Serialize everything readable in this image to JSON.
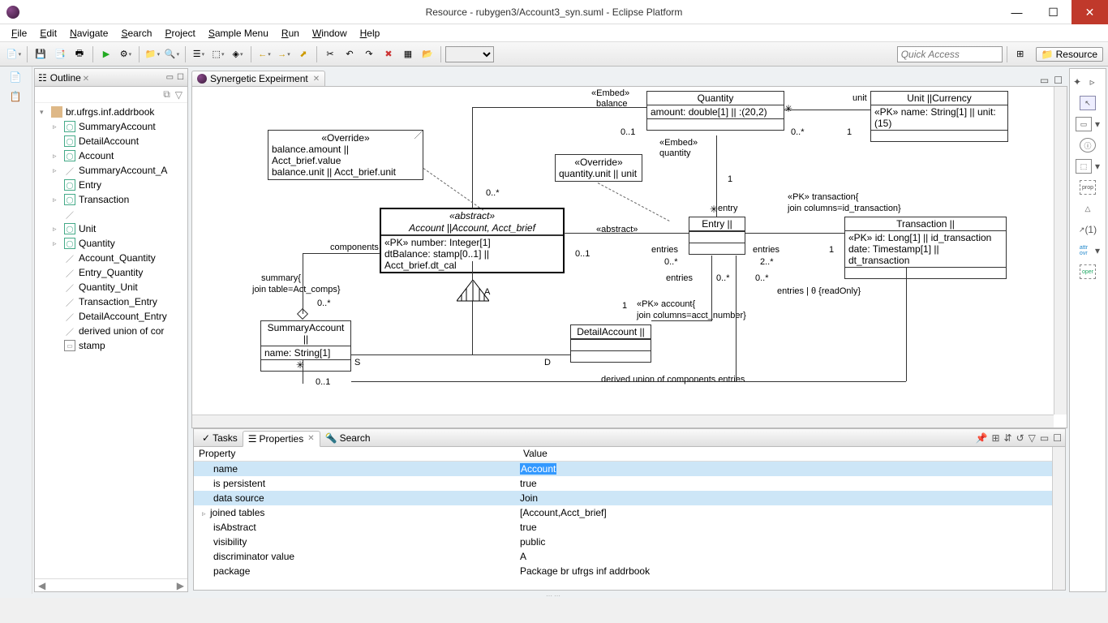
{
  "titlebar": {
    "title": "Resource - rubygen3/Account3_syn.suml - Eclipse Platform"
  },
  "menu": [
    "File",
    "Edit",
    "Navigate",
    "Search",
    "Project",
    "Sample Menu",
    "Run",
    "Window",
    "Help"
  ],
  "quick_access_placeholder": "Quick Access",
  "perspective_label": "Resource",
  "outline": {
    "title": "Outline",
    "root": "br.ufrgs.inf.addrbook",
    "items": [
      {
        "icon": "c",
        "label": "SummaryAccount",
        "tw": "▹"
      },
      {
        "icon": "c",
        "label": "DetailAccount",
        "tw": ""
      },
      {
        "icon": "c",
        "label": "Account",
        "tw": "▹"
      },
      {
        "icon": "l",
        "label": "SummaryAccount_A",
        "tw": "▹"
      },
      {
        "icon": "c",
        "label": "Entry",
        "tw": ""
      },
      {
        "icon": "c",
        "label": "Transaction",
        "tw": "▹"
      },
      {
        "icon": "l",
        "label": "",
        "tw": ""
      },
      {
        "icon": "c",
        "label": "Unit",
        "tw": "▹"
      },
      {
        "icon": "c",
        "label": "Quantity",
        "tw": "▹"
      },
      {
        "icon": "l",
        "label": "Account_Quantity",
        "tw": ""
      },
      {
        "icon": "l",
        "label": "Entry_Quantity",
        "tw": ""
      },
      {
        "icon": "l",
        "label": "Quantity_Unit",
        "tw": ""
      },
      {
        "icon": "l",
        "label": "Transaction_Entry",
        "tw": ""
      },
      {
        "icon": "l",
        "label": "DetailAccount_Entry",
        "tw": ""
      },
      {
        "icon": "l",
        "label": "derived union of cor",
        "tw": ""
      },
      {
        "icon": "r",
        "label": "stamp",
        "tw": ""
      }
    ]
  },
  "editor_tab": "Synergetic Expeirment",
  "diagram": {
    "quantity_title": "Quantity",
    "quantity_body": "amount: double[1] || :(20,2)",
    "unit_title": "Unit ||Currency",
    "unit_body": "«PK» name: String[1] || unit:(15)",
    "embed_balance_s": "«Embed»",
    "embed_balance": "balance",
    "embed_quantity_s": "«Embed»",
    "embed_quantity": "quantity",
    "unit_lbl": "unit",
    "m01": "0..1",
    "m0s": "0..*",
    "m1": "1",
    "m2s": "2..*",
    "override1_s": "«Override»",
    "override1_l1": "balance.amount || Acct_brief.value",
    "override1_l2": "balance.unit || Acct_brief.unit",
    "override2_s": "«Override»",
    "override2_l": "quantity.unit || unit",
    "account_s": "«abstract»",
    "account_t": "Account ||Account, Acct_brief",
    "account_l1": "«PK» number: Integer[1]",
    "account_l2": "dtBalance: stamp[0..1] || Acct_brief.dt_cal",
    "components": "components",
    "summary_j1": "summary{",
    "summary_j2": "join table=Act_comps}",
    "abstract_lbl": "«abstract»",
    "entry_title": "Entry ||",
    "entry_lbl": "entry",
    "entries_lbl": "entries",
    "entries_ro": "entries | θ {readOnly}",
    "trans_pk": "«PK» transaction{",
    "trans_jc": "join columns=id_transaction}",
    "trans_title": "Transaction ||",
    "trans_l1": "«PK» id: Long[1] || id_transaction",
    "trans_l2": "date: Timestamp[1] || dt_transaction",
    "summary_title": "SummaryAccount ||",
    "summary_body": "name: String[1]",
    "detail_title": "DetailAccount ||",
    "acct_pk1": "«PK» account{",
    "acct_pk2": "join columns=acct_number}",
    "derived_union": "derived union of components.entries",
    "A": "A",
    "S": "S",
    "D": "D"
  },
  "bottom": {
    "tab_tasks": "Tasks",
    "tab_properties": "Properties",
    "tab_search": "Search",
    "header_property": "Property",
    "header_value": "Value",
    "rows": [
      {
        "k": "name",
        "v": "Account",
        "sel": true,
        "vsel": true
      },
      {
        "k": "is persistent",
        "v": "true"
      },
      {
        "k": "data source",
        "v": "Join",
        "sel": true
      },
      {
        "k": "joined tables",
        "v": "[Account,Acct_brief]",
        "tw": "▹"
      },
      {
        "k": "isAbstract",
        "v": "true"
      },
      {
        "k": "visibility",
        "v": "public"
      },
      {
        "k": "discriminator value",
        "v": "A"
      },
      {
        "k": "package",
        "v": "Package br ufrgs inf addrbook"
      }
    ]
  }
}
